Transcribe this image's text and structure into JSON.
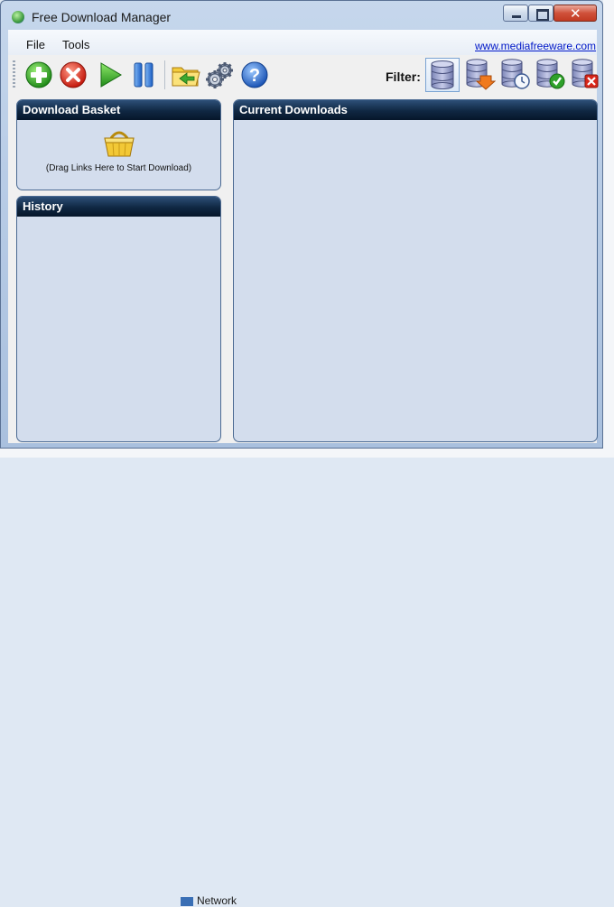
{
  "window": {
    "title": "Free Download Manager"
  },
  "menu": {
    "items": [
      "File",
      "Tools"
    ],
    "site_link": "www.mediafreeware.com"
  },
  "toolbar": {
    "buttons": [
      "add-icon",
      "delete-icon",
      "start-icon",
      "pause-icon",
      "open-folder-icon",
      "settings-icon",
      "help-icon"
    ],
    "filter_label": "Filter:",
    "filters": [
      "all-downloads-icon",
      "downloading-icon",
      "scheduled-icon",
      "completed-icon",
      "failed-icon"
    ]
  },
  "panels": {
    "basket": {
      "title": "Download Basket",
      "hint": "(Drag Links Here to Start Download)"
    },
    "history": {
      "title": "History"
    },
    "current": {
      "title": "Current Downloads"
    }
  },
  "background": {
    "taskbar_item": "Network"
  },
  "colors": {
    "panel_header": "#0f2742",
    "panel_body": "#d3dded",
    "link": "#0018c8"
  }
}
